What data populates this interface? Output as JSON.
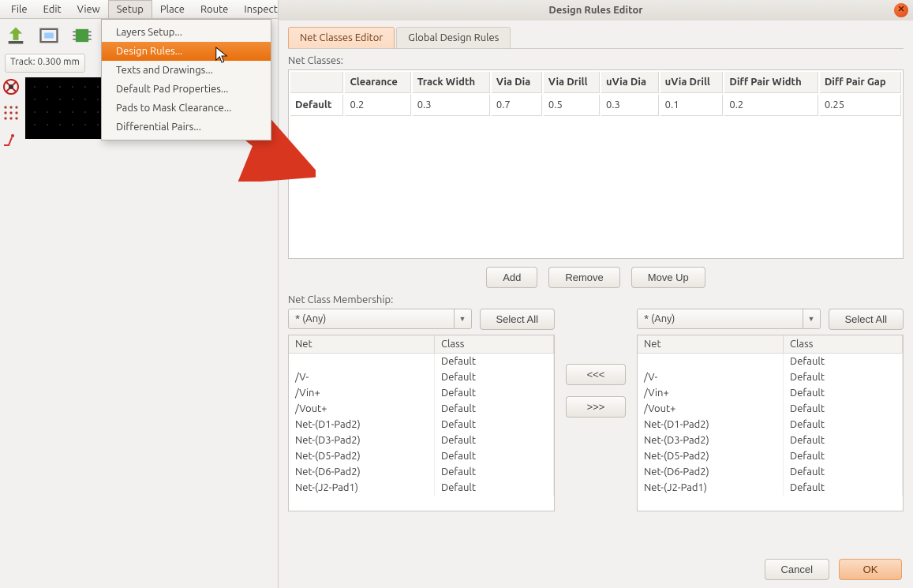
{
  "menubar": {
    "items": [
      "File",
      "Edit",
      "View",
      "Setup",
      "Place",
      "Route",
      "Inspect"
    ]
  },
  "track_indicator": "Track: 0.300 mm",
  "setup_menu": {
    "items": [
      "Layers Setup...",
      "Design Rules...",
      "Texts and Drawings...",
      "Default Pad Properties...",
      "Pads to Mask Clearance...",
      "Differential Pairs..."
    ],
    "highlighted_index": 1
  },
  "dialog": {
    "title": "Design Rules Editor",
    "tabs": {
      "net_classes": "Net Classes Editor",
      "global": "Global Design Rules"
    },
    "labels": {
      "net_classes": "Net Classes:",
      "membership": "Net Class Membership:"
    },
    "netclass_table": {
      "headers": [
        "",
        "Clearance",
        "Track Width",
        "Via Dia",
        "Via Drill",
        "uVia Dia",
        "uVia Drill",
        "Diff Pair Width",
        "Diff Pair Gap"
      ],
      "rows": [
        {
          "name": "Default",
          "values": [
            "0.2",
            "0.3",
            "0.7",
            "0.5",
            "0.3",
            "0.1",
            "0.2",
            "0.25"
          ]
        }
      ]
    },
    "buttons": {
      "add": "Add",
      "remove": "Remove",
      "moveup": "Move Up",
      "selectall": "Select All",
      "left": "<<<",
      "right": ">>>",
      "cancel": "Cancel",
      "ok": "OK"
    },
    "combo_value": "* (Any)",
    "net_list": {
      "headers": [
        "Net",
        "Class"
      ],
      "rows": [
        {
          "net": "",
          "cls": "Default"
        },
        {
          "net": "/V-",
          "cls": "Default"
        },
        {
          "net": "/Vin+",
          "cls": "Default"
        },
        {
          "net": "/Vout+",
          "cls": "Default"
        },
        {
          "net": "Net-(D1-Pad2)",
          "cls": "Default"
        },
        {
          "net": "Net-(D3-Pad2)",
          "cls": "Default"
        },
        {
          "net": "Net-(D5-Pad2)",
          "cls": "Default"
        },
        {
          "net": "Net-(D6-Pad2)",
          "cls": "Default"
        },
        {
          "net": "Net-(J2-Pad1)",
          "cls": "Default"
        }
      ]
    }
  }
}
